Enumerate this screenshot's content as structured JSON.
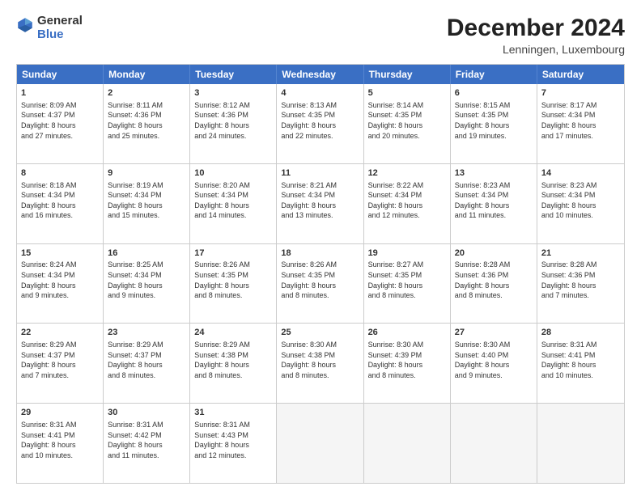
{
  "logo": {
    "general": "General",
    "blue": "Blue"
  },
  "header": {
    "month": "December 2024",
    "location": "Lenningen, Luxembourg"
  },
  "days": [
    "Sunday",
    "Monday",
    "Tuesday",
    "Wednesday",
    "Thursday",
    "Friday",
    "Saturday"
  ],
  "weeks": [
    [
      {
        "day": 1,
        "lines": [
          "Sunrise: 8:09 AM",
          "Sunset: 4:37 PM",
          "Daylight: 8 hours",
          "and 27 minutes."
        ]
      },
      {
        "day": 2,
        "lines": [
          "Sunrise: 8:11 AM",
          "Sunset: 4:36 PM",
          "Daylight: 8 hours",
          "and 25 minutes."
        ]
      },
      {
        "day": 3,
        "lines": [
          "Sunrise: 8:12 AM",
          "Sunset: 4:36 PM",
          "Daylight: 8 hours",
          "and 24 minutes."
        ]
      },
      {
        "day": 4,
        "lines": [
          "Sunrise: 8:13 AM",
          "Sunset: 4:35 PM",
          "Daylight: 8 hours",
          "and 22 minutes."
        ]
      },
      {
        "day": 5,
        "lines": [
          "Sunrise: 8:14 AM",
          "Sunset: 4:35 PM",
          "Daylight: 8 hours",
          "and 20 minutes."
        ]
      },
      {
        "day": 6,
        "lines": [
          "Sunrise: 8:15 AM",
          "Sunset: 4:35 PM",
          "Daylight: 8 hours",
          "and 19 minutes."
        ]
      },
      {
        "day": 7,
        "lines": [
          "Sunrise: 8:17 AM",
          "Sunset: 4:34 PM",
          "Daylight: 8 hours",
          "and 17 minutes."
        ]
      }
    ],
    [
      {
        "day": 8,
        "lines": [
          "Sunrise: 8:18 AM",
          "Sunset: 4:34 PM",
          "Daylight: 8 hours",
          "and 16 minutes."
        ]
      },
      {
        "day": 9,
        "lines": [
          "Sunrise: 8:19 AM",
          "Sunset: 4:34 PM",
          "Daylight: 8 hours",
          "and 15 minutes."
        ]
      },
      {
        "day": 10,
        "lines": [
          "Sunrise: 8:20 AM",
          "Sunset: 4:34 PM",
          "Daylight: 8 hours",
          "and 14 minutes."
        ]
      },
      {
        "day": 11,
        "lines": [
          "Sunrise: 8:21 AM",
          "Sunset: 4:34 PM",
          "Daylight: 8 hours",
          "and 13 minutes."
        ]
      },
      {
        "day": 12,
        "lines": [
          "Sunrise: 8:22 AM",
          "Sunset: 4:34 PM",
          "Daylight: 8 hours",
          "and 12 minutes."
        ]
      },
      {
        "day": 13,
        "lines": [
          "Sunrise: 8:23 AM",
          "Sunset: 4:34 PM",
          "Daylight: 8 hours",
          "and 11 minutes."
        ]
      },
      {
        "day": 14,
        "lines": [
          "Sunrise: 8:23 AM",
          "Sunset: 4:34 PM",
          "Daylight: 8 hours",
          "and 10 minutes."
        ]
      }
    ],
    [
      {
        "day": 15,
        "lines": [
          "Sunrise: 8:24 AM",
          "Sunset: 4:34 PM",
          "Daylight: 8 hours",
          "and 9 minutes."
        ]
      },
      {
        "day": 16,
        "lines": [
          "Sunrise: 8:25 AM",
          "Sunset: 4:34 PM",
          "Daylight: 8 hours",
          "and 9 minutes."
        ]
      },
      {
        "day": 17,
        "lines": [
          "Sunrise: 8:26 AM",
          "Sunset: 4:35 PM",
          "Daylight: 8 hours",
          "and 8 minutes."
        ]
      },
      {
        "day": 18,
        "lines": [
          "Sunrise: 8:26 AM",
          "Sunset: 4:35 PM",
          "Daylight: 8 hours",
          "and 8 minutes."
        ]
      },
      {
        "day": 19,
        "lines": [
          "Sunrise: 8:27 AM",
          "Sunset: 4:35 PM",
          "Daylight: 8 hours",
          "and 8 minutes."
        ]
      },
      {
        "day": 20,
        "lines": [
          "Sunrise: 8:28 AM",
          "Sunset: 4:36 PM",
          "Daylight: 8 hours",
          "and 8 minutes."
        ]
      },
      {
        "day": 21,
        "lines": [
          "Sunrise: 8:28 AM",
          "Sunset: 4:36 PM",
          "Daylight: 8 hours",
          "and 7 minutes."
        ]
      }
    ],
    [
      {
        "day": 22,
        "lines": [
          "Sunrise: 8:29 AM",
          "Sunset: 4:37 PM",
          "Daylight: 8 hours",
          "and 7 minutes."
        ]
      },
      {
        "day": 23,
        "lines": [
          "Sunrise: 8:29 AM",
          "Sunset: 4:37 PM",
          "Daylight: 8 hours",
          "and 8 minutes."
        ]
      },
      {
        "day": 24,
        "lines": [
          "Sunrise: 8:29 AM",
          "Sunset: 4:38 PM",
          "Daylight: 8 hours",
          "and 8 minutes."
        ]
      },
      {
        "day": 25,
        "lines": [
          "Sunrise: 8:30 AM",
          "Sunset: 4:38 PM",
          "Daylight: 8 hours",
          "and 8 minutes."
        ]
      },
      {
        "day": 26,
        "lines": [
          "Sunrise: 8:30 AM",
          "Sunset: 4:39 PM",
          "Daylight: 8 hours",
          "and 8 minutes."
        ]
      },
      {
        "day": 27,
        "lines": [
          "Sunrise: 8:30 AM",
          "Sunset: 4:40 PM",
          "Daylight: 8 hours",
          "and 9 minutes."
        ]
      },
      {
        "day": 28,
        "lines": [
          "Sunrise: 8:31 AM",
          "Sunset: 4:41 PM",
          "Daylight: 8 hours",
          "and 10 minutes."
        ]
      }
    ],
    [
      {
        "day": 29,
        "lines": [
          "Sunrise: 8:31 AM",
          "Sunset: 4:41 PM",
          "Daylight: 8 hours",
          "and 10 minutes."
        ]
      },
      {
        "day": 30,
        "lines": [
          "Sunrise: 8:31 AM",
          "Sunset: 4:42 PM",
          "Daylight: 8 hours",
          "and 11 minutes."
        ]
      },
      {
        "day": 31,
        "lines": [
          "Sunrise: 8:31 AM",
          "Sunset: 4:43 PM",
          "Daylight: 8 hours",
          "and 12 minutes."
        ]
      },
      null,
      null,
      null,
      null
    ]
  ]
}
